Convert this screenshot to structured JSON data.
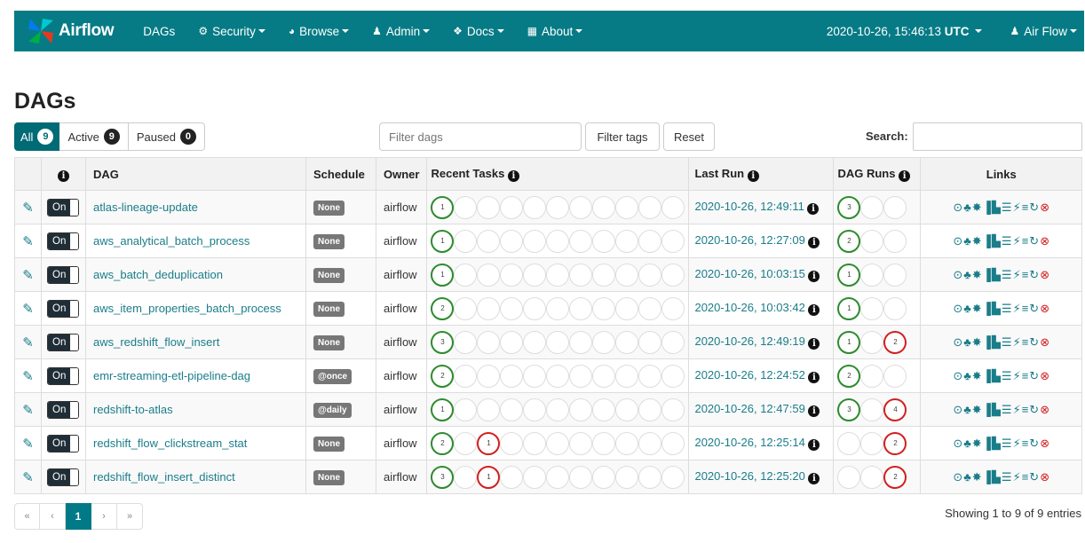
{
  "navbar": {
    "brand": "Airflow",
    "items": [
      {
        "label": "DAGs",
        "icon": "",
        "dropdown": false
      },
      {
        "label": "Security",
        "icon": "cogs-icon",
        "dropdown": true
      },
      {
        "label": "Browse",
        "icon": "globe-icon",
        "dropdown": true
      },
      {
        "label": "Admin",
        "icon": "user-icon",
        "dropdown": true
      },
      {
        "label": "Docs",
        "icon": "cube-icon",
        "dropdown": true
      },
      {
        "label": "About",
        "icon": "grid-icon",
        "dropdown": true
      }
    ],
    "clock_time": "2020-10-26, 15:46:13",
    "clock_tz": "UTC",
    "user": "Air Flow"
  },
  "page_title": "DAGs",
  "filters": {
    "all_label": "All",
    "all_count": "9",
    "active_label": "Active",
    "active_count": "9",
    "paused_label": "Paused",
    "paused_count": "0",
    "filter_placeholder": "Filter dags",
    "filter_tags_label": "Filter tags",
    "reset_label": "Reset",
    "search_label": "Search:"
  },
  "table": {
    "headers": {
      "dag": "DAG",
      "schedule": "Schedule",
      "owner": "Owner",
      "recent_tasks": "Recent Tasks",
      "last_run": "Last Run",
      "dag_runs": "DAG Runs",
      "links": "Links"
    },
    "toggle_label": "On",
    "rows": [
      {
        "dag": "atlas-lineage-update",
        "schedule": "None",
        "owner": "airflow",
        "tasks": [
          {
            "n": "1",
            "c": "g"
          }
        ],
        "last_run": "2020-10-26, 12:49:11",
        "runs": [
          {
            "n": "3",
            "c": "g"
          },
          {
            "n": "",
            "c": ""
          },
          {
            "n": "",
            "c": ""
          }
        ]
      },
      {
        "dag": "aws_analytical_batch_process",
        "schedule": "None",
        "owner": "airflow",
        "tasks": [
          {
            "n": "1",
            "c": "g"
          }
        ],
        "last_run": "2020-10-26, 12:27:09",
        "runs": [
          {
            "n": "2",
            "c": "g"
          },
          {
            "n": "",
            "c": ""
          },
          {
            "n": "",
            "c": ""
          }
        ]
      },
      {
        "dag": "aws_batch_deduplication",
        "schedule": "None",
        "owner": "airflow",
        "tasks": [
          {
            "n": "1",
            "c": "g"
          }
        ],
        "last_run": "2020-10-26, 10:03:15",
        "runs": [
          {
            "n": "1",
            "c": "g"
          },
          {
            "n": "",
            "c": ""
          },
          {
            "n": "",
            "c": ""
          }
        ]
      },
      {
        "dag": "aws_item_properties_batch_process",
        "schedule": "None",
        "owner": "airflow",
        "tasks": [
          {
            "n": "2",
            "c": "g"
          }
        ],
        "last_run": "2020-10-26, 10:03:42",
        "runs": [
          {
            "n": "1",
            "c": "g"
          },
          {
            "n": "",
            "c": ""
          },
          {
            "n": "",
            "c": ""
          }
        ]
      },
      {
        "dag": "aws_redshift_flow_insert",
        "schedule": "None",
        "owner": "airflow",
        "tasks": [
          {
            "n": "3",
            "c": "g"
          }
        ],
        "last_run": "2020-10-26, 12:49:19",
        "runs": [
          {
            "n": "1",
            "c": "g"
          },
          {
            "n": "",
            "c": ""
          },
          {
            "n": "2",
            "c": "r"
          }
        ]
      },
      {
        "dag": "emr-streaming-etl-pipeline-dag",
        "schedule": "@once",
        "owner": "airflow",
        "tasks": [
          {
            "n": "2",
            "c": "g"
          }
        ],
        "last_run": "2020-10-26, 12:24:52",
        "runs": [
          {
            "n": "2",
            "c": "g"
          },
          {
            "n": "",
            "c": ""
          },
          {
            "n": "",
            "c": ""
          }
        ]
      },
      {
        "dag": "redshift-to-atlas",
        "schedule": "@daily",
        "owner": "airflow",
        "tasks": [
          {
            "n": "1",
            "c": "g"
          }
        ],
        "last_run": "2020-10-26, 12:47:59",
        "runs": [
          {
            "n": "3",
            "c": "g"
          },
          {
            "n": "",
            "c": ""
          },
          {
            "n": "4",
            "c": "r"
          }
        ]
      },
      {
        "dag": "redshift_flow_clickstream_stat",
        "schedule": "None",
        "owner": "airflow",
        "tasks": [
          {
            "n": "2",
            "c": "g"
          },
          {
            "n": "",
            "c": ""
          },
          {
            "n": "1",
            "c": "r"
          }
        ],
        "last_run": "2020-10-26, 12:25:14",
        "runs": [
          {
            "n": "",
            "c": ""
          },
          {
            "n": "",
            "c": ""
          },
          {
            "n": "2",
            "c": "r"
          }
        ]
      },
      {
        "dag": "redshift_flow_insert_distinct",
        "schedule": "None",
        "owner": "airflow",
        "tasks": [
          {
            "n": "3",
            "c": "g"
          },
          {
            "n": "",
            "c": ""
          },
          {
            "n": "1",
            "c": "r"
          }
        ],
        "last_run": "2020-10-26, 12:25:20",
        "runs": [
          {
            "n": "",
            "c": ""
          },
          {
            "n": "",
            "c": ""
          },
          {
            "n": "2",
            "c": "r"
          }
        ]
      }
    ],
    "link_icons": [
      "trigger-dag-icon",
      "tree-view-icon",
      "graph-view-icon",
      "tries-icon",
      "landing-times-icon",
      "gantt-icon",
      "code-icon",
      "logs-icon",
      "refresh-icon",
      "delete-icon"
    ]
  },
  "pagination": {
    "first": "«",
    "prev": "‹",
    "current": "1",
    "next": "›",
    "last": "»",
    "summary": "Showing 1 to 9 of 9 entries"
  },
  "colors": {
    "navbar": "#067b85",
    "link": "#1a7d8a",
    "success": "#2e8b2e",
    "failed": "#d12020"
  }
}
